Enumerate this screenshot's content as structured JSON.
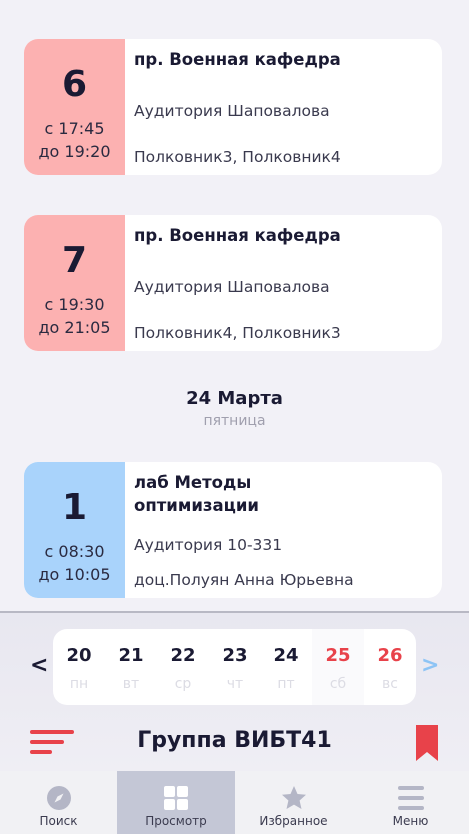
{
  "schedule": {
    "lessons": [
      {
        "number": "6",
        "from": "с 17:45",
        "to": "до 19:20",
        "title": "пр. Военная кафедра",
        "room": "Аудитория Шаповалова",
        "teacher": "Полковник3, Полковник4",
        "color": "#fcb1b1"
      },
      {
        "number": "7",
        "from": "с 19:30",
        "to": "до 21:05",
        "title": "пр. Военная кафедра",
        "room": "Аудитория Шаповалова",
        "teacher": "Полковник4, Полковник3",
        "color": "#fcb1b1"
      },
      {
        "number": "1",
        "from": "с 08:30",
        "to": "до 10:05",
        "title": "лаб Методы оптимизации",
        "room": "Аудитория 10-331",
        "teacher": "доц.Полуян Анна Юрьевна",
        "color": "#a9d3fb"
      }
    ],
    "date_header": {
      "date": "24 Марта",
      "weekday": "пятница"
    }
  },
  "week_nav": {
    "prev_symbol": "<",
    "next_symbol": ">",
    "days": [
      {
        "num": "20",
        "label": "пн",
        "weekend": false
      },
      {
        "num": "21",
        "label": "вт",
        "weekend": false
      },
      {
        "num": "22",
        "label": "ср",
        "weekend": false
      },
      {
        "num": "23",
        "label": "чт",
        "weekend": false
      },
      {
        "num": "24",
        "label": "пт",
        "weekend": false
      },
      {
        "num": "25",
        "label": "сб",
        "weekend": true
      },
      {
        "num": "26",
        "label": "вс",
        "weekend": true
      }
    ]
  },
  "header": {
    "group_title": "Группа ВИБТ41",
    "menu_icon": "sort-lines-icon",
    "bookmark_icon": "bookmark-icon"
  },
  "tabbar": {
    "tabs": [
      {
        "label": "Поиск",
        "icon": "compass-icon",
        "active": false
      },
      {
        "label": "Просмотр",
        "icon": "grid-icon",
        "active": true
      },
      {
        "label": "Избранное",
        "icon": "star-icon",
        "active": false
      },
      {
        "label": "Меню",
        "icon": "hamburger-icon",
        "active": false
      }
    ]
  },
  "colors": {
    "accent_red": "#e8424a",
    "accent_blue": "#8dc4f5",
    "lesson_practice": "#fcb1b1",
    "lesson_lab": "#a9d3fb",
    "tab_active": "#c4c7d6"
  }
}
